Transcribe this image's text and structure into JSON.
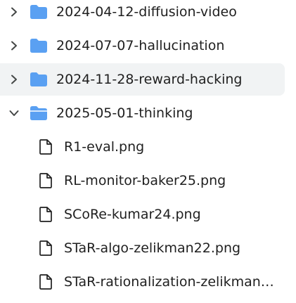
{
  "tree": {
    "folders": [
      {
        "name": "2024-04-12-diffusion-video",
        "expanded": false
      },
      {
        "name": "2024-07-07-hallucination",
        "expanded": false
      },
      {
        "name": "2024-11-28-reward-hacking",
        "expanded": false,
        "hovered": true
      },
      {
        "name": "2025-05-01-thinking",
        "expanded": true
      }
    ],
    "files": [
      {
        "name": "R1-eval.png"
      },
      {
        "name": "RL-monitor-baker25.png"
      },
      {
        "name": "SCoRe-kumar24.png"
      },
      {
        "name": "STaR-algo-zelikman22.png"
      },
      {
        "name": "STaR-rationalization-zelikman2..."
      }
    ]
  },
  "colors": {
    "folder_icon": "#5aa0f2",
    "hover_bg": "#f1f3f4",
    "chevron": "#444746",
    "text": "#1f1f1f"
  },
  "icons": {
    "collapsed": "chevron-right-icon",
    "expanded": "chevron-down-icon",
    "folder": "folder-icon",
    "file": "file-icon"
  }
}
